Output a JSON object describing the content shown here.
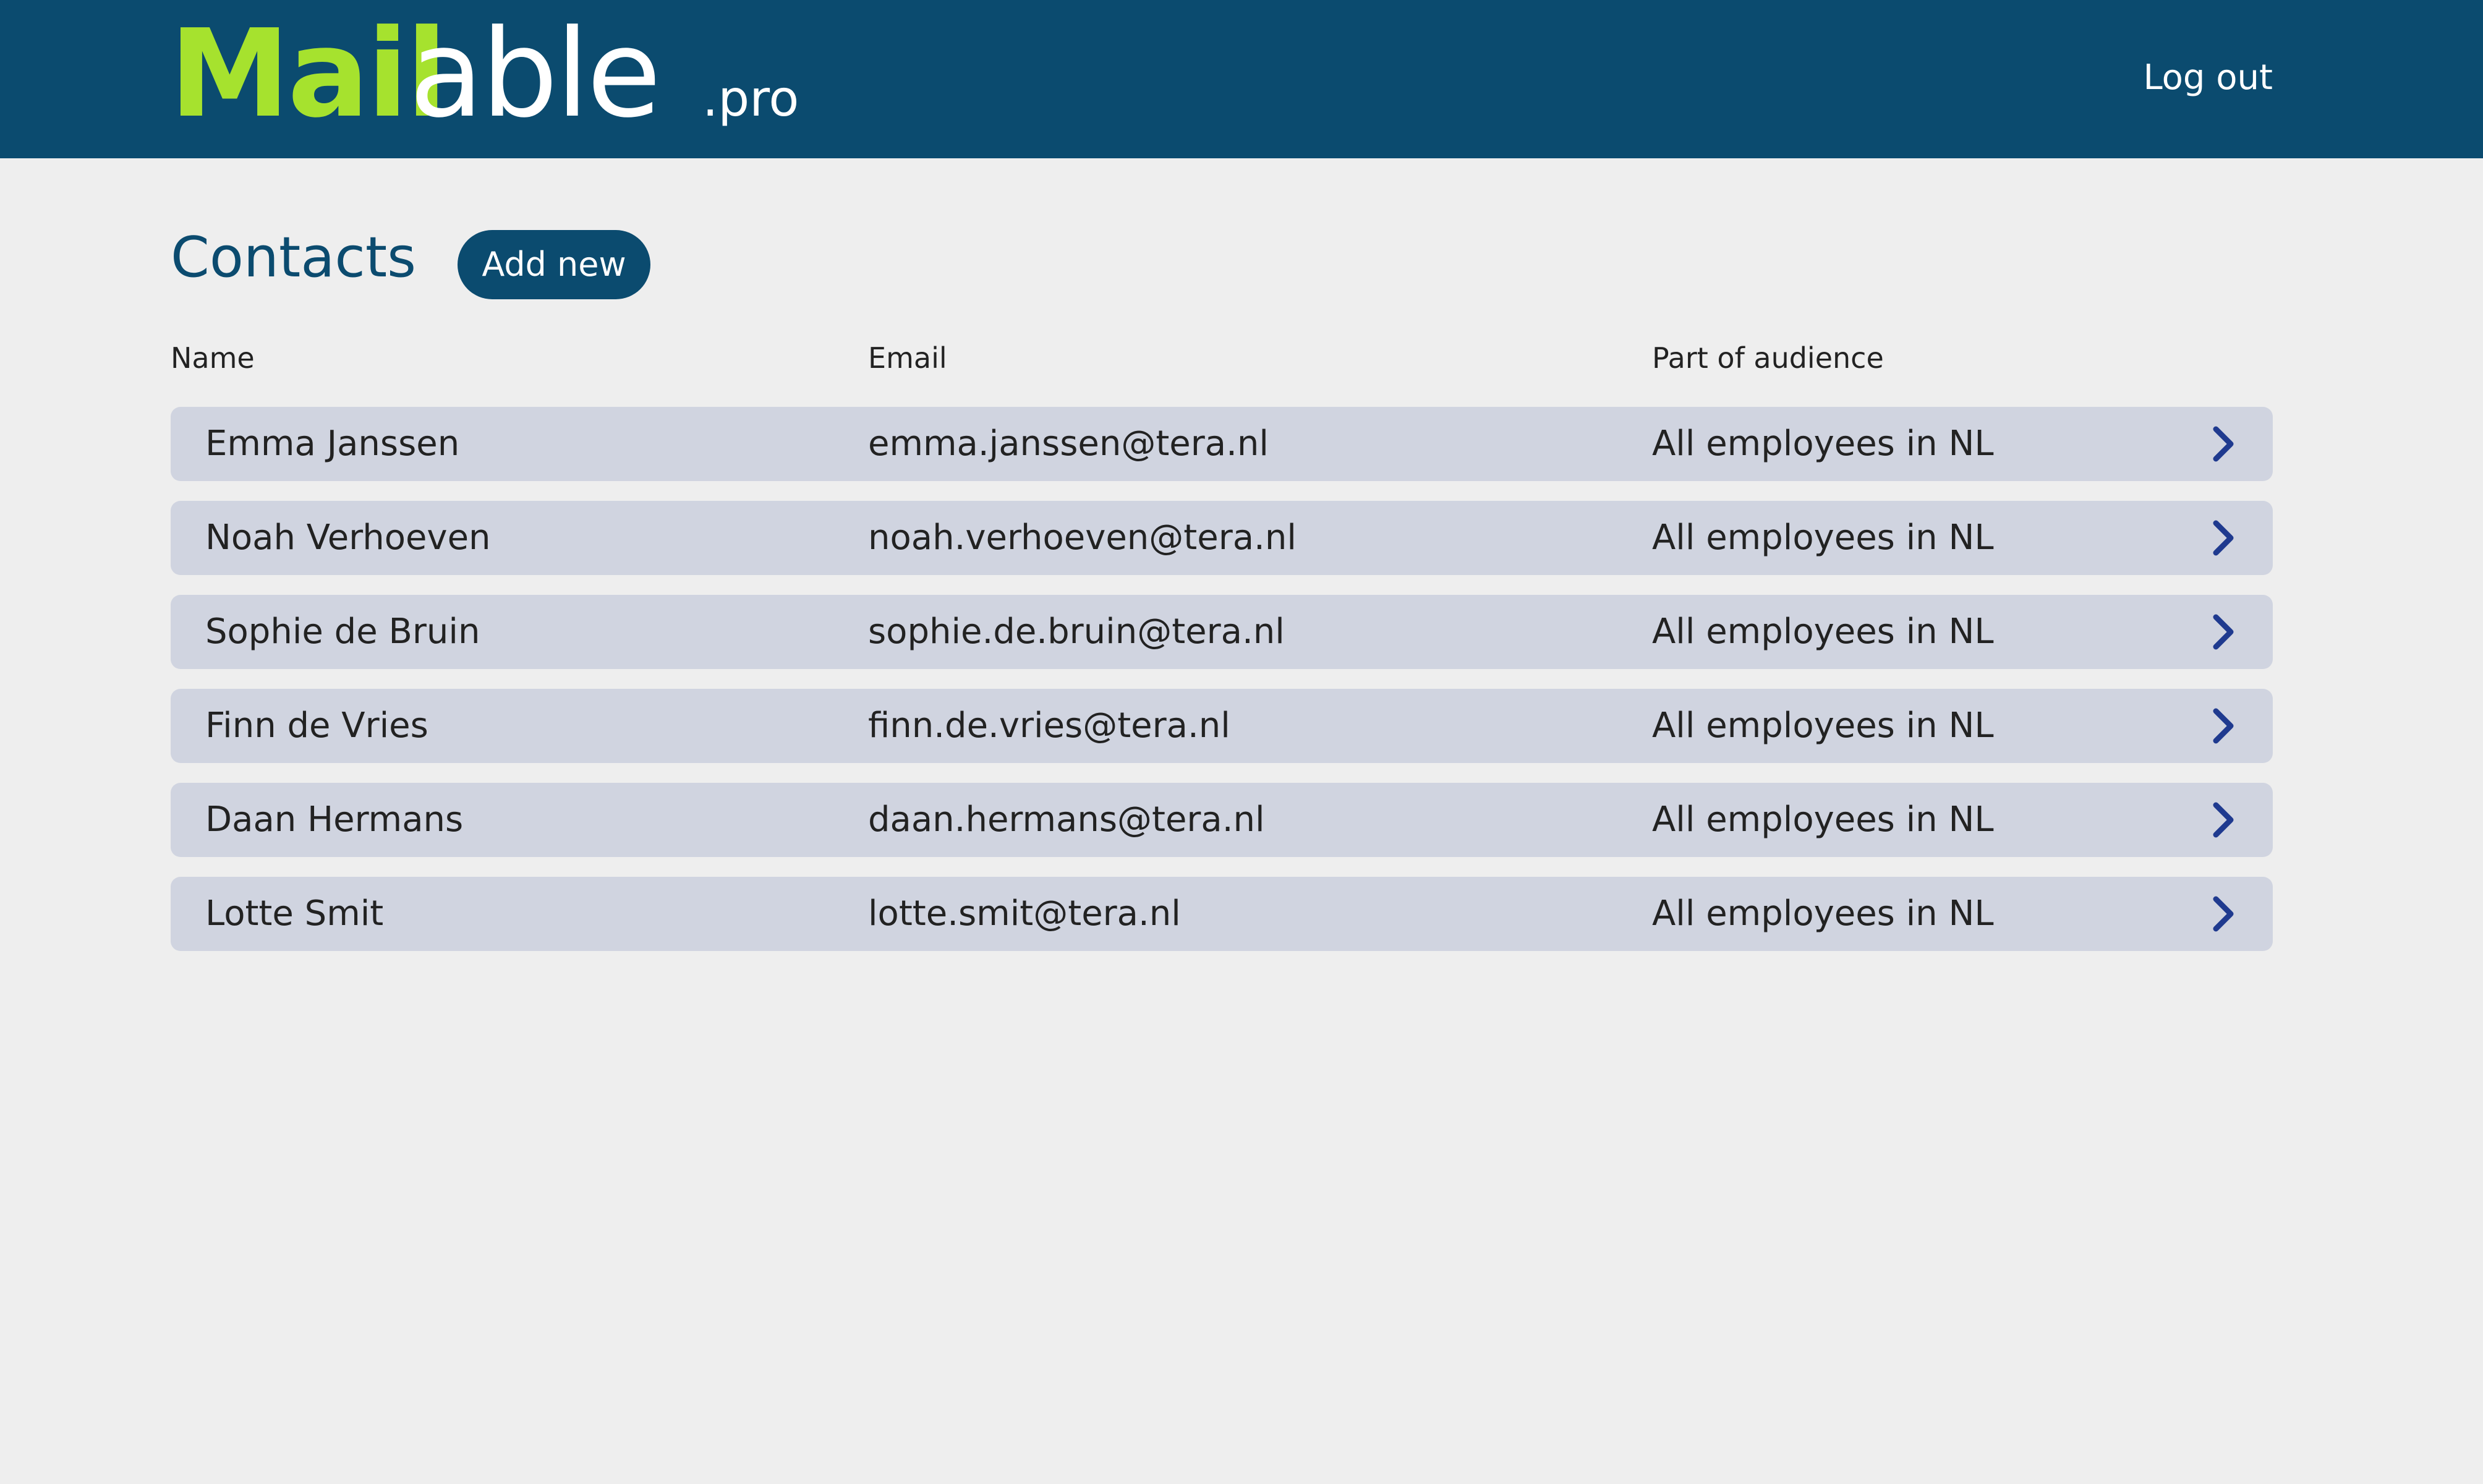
{
  "header": {
    "logo_bold": "Mail",
    "logo_light": "able",
    "logo_suffix": ".pro",
    "logout_label": "Log out",
    "background": "#0b4b6f",
    "logo_accent": "#a6e22e"
  },
  "main": {
    "title": "Contacts",
    "add_button_label": "Add new",
    "columns": {
      "name": "Name",
      "email": "Email",
      "audience": "Part of audience"
    },
    "row_icon": "chevron-right-icon",
    "contacts": [
      {
        "name": "Emma Janssen",
        "email": "emma.janssen@tera.nl",
        "audience": "All employees in NL"
      },
      {
        "name": "Noah Verhoeven",
        "email": "noah.verhoeven@tera.nl",
        "audience": "All employees in NL"
      },
      {
        "name": "Sophie de Bruin",
        "email": "sophie.de.bruin@tera.nl",
        "audience": "All employees in NL"
      },
      {
        "name": "Finn de Vries",
        "email": "finn.de.vries@tera.nl",
        "audience": "All employees in NL"
      },
      {
        "name": "Daan Hermans",
        "email": "daan.hermans@tera.nl",
        "audience": "All employees in NL"
      },
      {
        "name": "Lotte Smit",
        "email": "lotte.smit@tera.nl",
        "audience": "All employees in NL"
      }
    ]
  }
}
